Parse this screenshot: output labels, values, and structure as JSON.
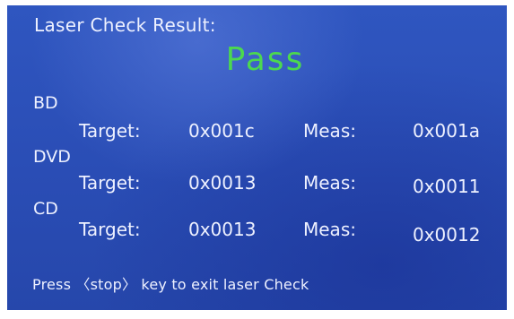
{
  "header": {
    "title": "Laser Check Result:",
    "result": "Pass",
    "result_color": "#4cd84f"
  },
  "sections": [
    {
      "name": "BD",
      "target_label": "Target:",
      "target": "0x001c",
      "meas_label": "Meas:",
      "meas": "0x001a"
    },
    {
      "name": "DVD",
      "target_label": "Target:",
      "target": "0x0013",
      "meas_label": "Meas:",
      "meas": "0x0011"
    },
    {
      "name": "CD",
      "target_label": "Target:",
      "target": "0x0013",
      "meas_label": "Meas:",
      "meas": "0x0012"
    }
  ],
  "footer": {
    "hint": "Press 〈stop〉 key to exit laser Check"
  },
  "colors": {
    "screen_background": "#2a4fb8",
    "text": "#eef1ff",
    "pass": "#4cd84f"
  }
}
